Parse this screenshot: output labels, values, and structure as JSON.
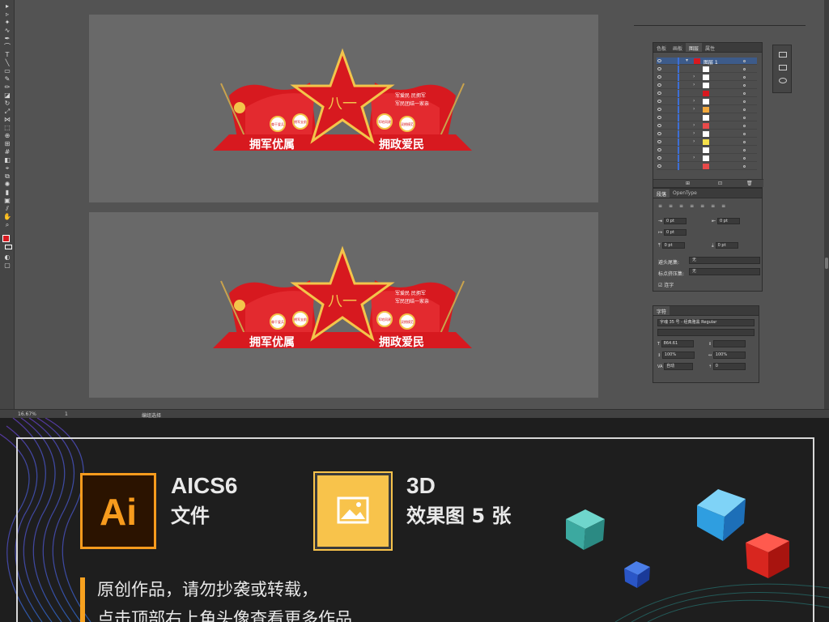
{
  "canvas": {
    "design": {
      "banner_left": "拥军优属",
      "banner_right": "拥政爱民",
      "slogan_line1": "军爱民  民拥军",
      "slogan_line2": "军民团结一家亲",
      "medal_left_1": "尊干爱兵",
      "medal_left_2": "拥军支前",
      "medal_right_1": "军地同建",
      "medal_right_2": "双拥模范",
      "star_mark": "八一"
    }
  },
  "statusbar": {
    "zoom": "16.67%",
    "artboard": "1",
    "tool_name": "编组选择"
  },
  "layers_panel": {
    "tabs": [
      "色板",
      "画板",
      "图层",
      "属性"
    ],
    "active_tab": "图层",
    "top_layer": "图层 1"
  },
  "paragraph_panel": {
    "tabs": [
      "段落",
      "OpenType"
    ],
    "indent_left": "0 pt",
    "indent_right": "0 pt",
    "first_line": "0 pt",
    "space_before": "0 pt",
    "space_after": "0 pt",
    "hanging_label": "避头尾集:",
    "hanging_value": "无",
    "punct_label": "标点挤压集:",
    "punct_value": "无",
    "hyphen_label": "连字"
  },
  "character_panel": {
    "tabs": [
      "字符"
    ],
    "font": "字魂 35 号 - 经典雅黑 Regular",
    "size": "864.61",
    "scale_h": "100%",
    "scale_v": "100%",
    "tracking": "自动",
    "baseline": "0"
  },
  "promo": {
    "ai_badge_text": "Ai",
    "ai_title": "AICS6",
    "ai_subtitle": "文件",
    "img_title": "3D",
    "img_subtitle": "效果图 5 张",
    "note_line1": "原创作品，请勿抄袭或转载，",
    "note_line2": "点击顶部右上角头像查看更多作品"
  },
  "colors": {
    "accent_orange": "#f79b1d",
    "accent_yellow": "#f8c34b",
    "design_red": "#d7191f"
  }
}
